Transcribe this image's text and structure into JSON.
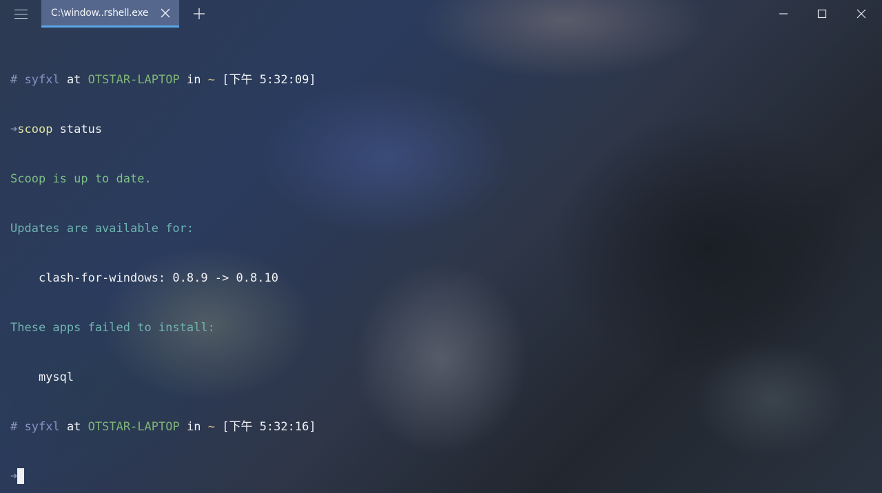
{
  "window": {
    "tab_title": "C:\\window..rshell.exe"
  },
  "terminal": {
    "prompt1": {
      "hash": "#",
      "user": "syfxl",
      "at": "at",
      "host": "OTSTAR-LAPTOP",
      "in": "in",
      "dir": "~",
      "time": "[下午 5:32:09]"
    },
    "command_line": {
      "arrow": "➜",
      "command": "scoop",
      "args": " status"
    },
    "output": [
      "Scoop is up to date.",
      "Updates are available for:",
      "    clash-for-windows: 0.8.9 -> 0.8.10",
      "These apps failed to install:",
      "    mysql"
    ],
    "prompt2": {
      "hash": "#",
      "user": "syfxl",
      "at": "at",
      "host": "OTSTAR-LAPTOP",
      "in": "in",
      "dir": "~",
      "time": "[下午 5:32:16]"
    },
    "input_arrow": "➜"
  },
  "colors": {
    "tab_accent": "#5aa7e8",
    "host": "#7fb477",
    "user": "#8b90c8",
    "status_green": "#7cbf86",
    "status_teal": "#6fb3b0",
    "command": "#e3e6a8"
  }
}
